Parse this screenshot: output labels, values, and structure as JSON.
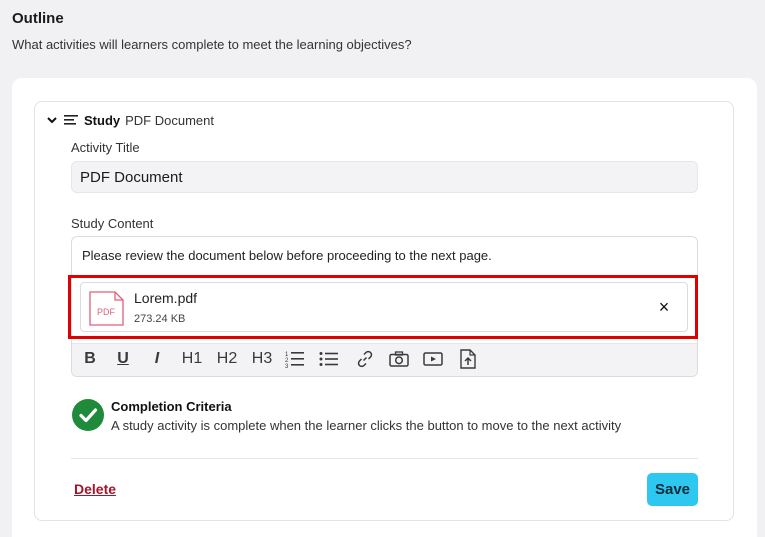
{
  "outline": {
    "title": "Outline",
    "subtitle": "What activities will learners complete to meet the learning objectives?"
  },
  "activity": {
    "type_label": "Study",
    "header_title": "PDF Document",
    "title_label": "Activity Title",
    "title_value": "PDF Document",
    "content_label": "Study Content",
    "content_text": "Please review the document below before proceeding to the next page.",
    "attachment": {
      "icon_text": "PDF",
      "file_name": "Lorem.pdf",
      "file_size": "273.24 KB",
      "remove_symbol": "×"
    },
    "toolbar": {
      "bold": "B",
      "underline": "U",
      "italic": "I",
      "h1": "H1",
      "h2": "H2",
      "h3": "H3"
    },
    "completion": {
      "title": "Completion Criteria",
      "description": "A study activity is complete when the learner clicks the button to move to the next activity"
    },
    "delete_label": "Delete",
    "save_label": "Save"
  },
  "colors": {
    "accent": "#2dc7f0",
    "delete": "#a4152b",
    "success": "#1f8a3a",
    "pdf": "#e0607a",
    "highlight": "#e00000"
  },
  "icons": [
    "chevron-down-icon",
    "list-icon",
    "pdf-file-icon",
    "close-icon",
    "numbered-list-icon",
    "bullet-list-icon",
    "link-icon",
    "camera-icon",
    "video-icon",
    "upload-file-icon",
    "check-circle-icon"
  ]
}
